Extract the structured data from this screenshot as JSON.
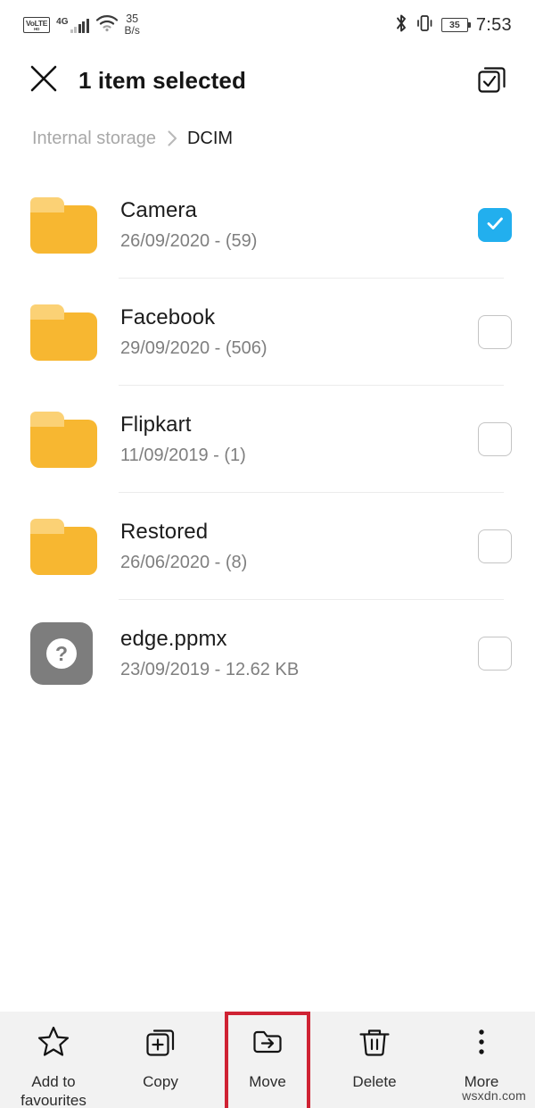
{
  "statusbar": {
    "volte_main": "VoLTE",
    "volte_sub": "HD",
    "network_label": "4G",
    "speed_value": "35",
    "speed_unit": "B/s",
    "bluetooth_icon": "bluetooth-icon",
    "vibrate_icon": "vibrate-icon",
    "battery_level": "35",
    "time": "7:53"
  },
  "header": {
    "close_icon": "close-icon",
    "title": "1 item selected",
    "select_all_icon": "select-all-icon"
  },
  "breadcrumb": {
    "root": "Internal storage",
    "separator": "›",
    "current": "DCIM"
  },
  "list": {
    "items": [
      {
        "name": "Camera",
        "sub": "26/09/2020 - (59)",
        "icon": "folder-icon",
        "checked": true
      },
      {
        "name": "Facebook",
        "sub": "29/09/2020 - (506)",
        "icon": "folder-icon",
        "checked": false
      },
      {
        "name": "Flipkart",
        "sub": "11/09/2019 - (1)",
        "icon": "folder-icon",
        "checked": false
      },
      {
        "name": "Restored",
        "sub": "26/06/2020 - (8)",
        "icon": "folder-icon",
        "checked": false
      },
      {
        "name": "edge.ppmx",
        "sub": "23/09/2019 - 12.62 KB",
        "icon": "unknown-file-icon",
        "checked": false
      }
    ]
  },
  "toolbar": {
    "items": [
      {
        "label": "Add to\nfavourites",
        "icon": "star-icon",
        "highlighted": false
      },
      {
        "label": "Copy",
        "icon": "copy-icon",
        "highlighted": false
      },
      {
        "label": "Move",
        "icon": "move-folder-icon",
        "highlighted": true
      },
      {
        "label": "Delete",
        "icon": "trash-icon",
        "highlighted": false
      },
      {
        "label": "More",
        "icon": "more-dots-icon",
        "highlighted": false
      }
    ]
  },
  "watermark": "wsxdn.com",
  "colors": {
    "accent_blue": "#22afee",
    "folder_yellow": "#f7b731",
    "highlight_red": "#cf2233",
    "toolbar_bg": "#f2f2f2"
  }
}
